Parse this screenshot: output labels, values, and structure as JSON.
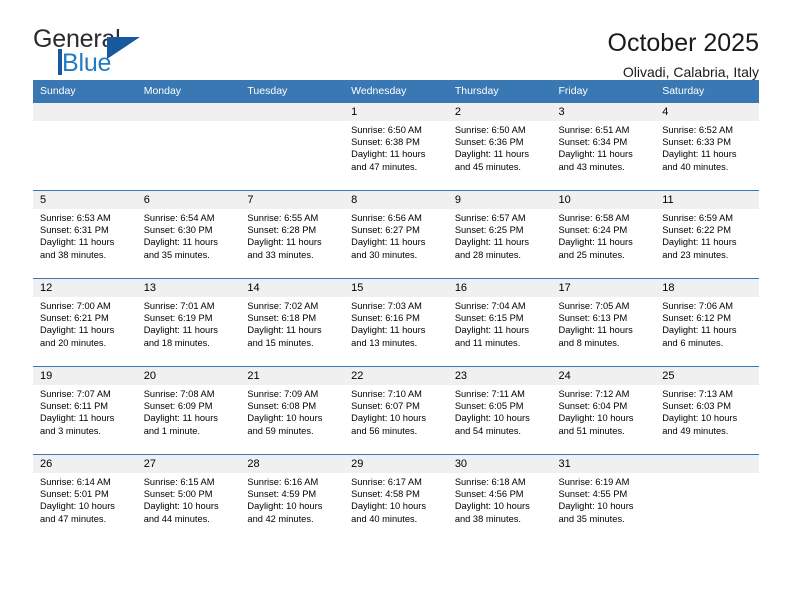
{
  "logo": {
    "word1": "General",
    "word2": "Blue",
    "triangle_color": "#18589f",
    "blue_text_color": "#1f7cc4"
  },
  "header": {
    "title": "October 2025",
    "location": "Olivadi, Calabria, Italy"
  },
  "theme": {
    "header_blue": "#3a78b4",
    "daynum_band": "#f0f0f0",
    "text": "#000000"
  },
  "weekday_headers": [
    "Sunday",
    "Monday",
    "Tuesday",
    "Wednesday",
    "Thursday",
    "Friday",
    "Saturday"
  ],
  "weeks": [
    [
      {
        "day": "",
        "sunrise": "",
        "sunset": "",
        "daylight1": "",
        "daylight2": ""
      },
      {
        "day": "",
        "sunrise": "",
        "sunset": "",
        "daylight1": "",
        "daylight2": ""
      },
      {
        "day": "",
        "sunrise": "",
        "sunset": "",
        "daylight1": "",
        "daylight2": ""
      },
      {
        "day": "1",
        "sunrise": "Sunrise: 6:50 AM",
        "sunset": "Sunset: 6:38 PM",
        "daylight1": "Daylight: 11 hours",
        "daylight2": "and 47 minutes."
      },
      {
        "day": "2",
        "sunrise": "Sunrise: 6:50 AM",
        "sunset": "Sunset: 6:36 PM",
        "daylight1": "Daylight: 11 hours",
        "daylight2": "and 45 minutes."
      },
      {
        "day": "3",
        "sunrise": "Sunrise: 6:51 AM",
        "sunset": "Sunset: 6:34 PM",
        "daylight1": "Daylight: 11 hours",
        "daylight2": "and 43 minutes."
      },
      {
        "day": "4",
        "sunrise": "Sunrise: 6:52 AM",
        "sunset": "Sunset: 6:33 PM",
        "daylight1": "Daylight: 11 hours",
        "daylight2": "and 40 minutes."
      }
    ],
    [
      {
        "day": "5",
        "sunrise": "Sunrise: 6:53 AM",
        "sunset": "Sunset: 6:31 PM",
        "daylight1": "Daylight: 11 hours",
        "daylight2": "and 38 minutes."
      },
      {
        "day": "6",
        "sunrise": "Sunrise: 6:54 AM",
        "sunset": "Sunset: 6:30 PM",
        "daylight1": "Daylight: 11 hours",
        "daylight2": "and 35 minutes."
      },
      {
        "day": "7",
        "sunrise": "Sunrise: 6:55 AM",
        "sunset": "Sunset: 6:28 PM",
        "daylight1": "Daylight: 11 hours",
        "daylight2": "and 33 minutes."
      },
      {
        "day": "8",
        "sunrise": "Sunrise: 6:56 AM",
        "sunset": "Sunset: 6:27 PM",
        "daylight1": "Daylight: 11 hours",
        "daylight2": "and 30 minutes."
      },
      {
        "day": "9",
        "sunrise": "Sunrise: 6:57 AM",
        "sunset": "Sunset: 6:25 PM",
        "daylight1": "Daylight: 11 hours",
        "daylight2": "and 28 minutes."
      },
      {
        "day": "10",
        "sunrise": "Sunrise: 6:58 AM",
        "sunset": "Sunset: 6:24 PM",
        "daylight1": "Daylight: 11 hours",
        "daylight2": "and 25 minutes."
      },
      {
        "day": "11",
        "sunrise": "Sunrise: 6:59 AM",
        "sunset": "Sunset: 6:22 PM",
        "daylight1": "Daylight: 11 hours",
        "daylight2": "and 23 minutes."
      }
    ],
    [
      {
        "day": "12",
        "sunrise": "Sunrise: 7:00 AM",
        "sunset": "Sunset: 6:21 PM",
        "daylight1": "Daylight: 11 hours",
        "daylight2": "and 20 minutes."
      },
      {
        "day": "13",
        "sunrise": "Sunrise: 7:01 AM",
        "sunset": "Sunset: 6:19 PM",
        "daylight1": "Daylight: 11 hours",
        "daylight2": "and 18 minutes."
      },
      {
        "day": "14",
        "sunrise": "Sunrise: 7:02 AM",
        "sunset": "Sunset: 6:18 PM",
        "daylight1": "Daylight: 11 hours",
        "daylight2": "and 15 minutes."
      },
      {
        "day": "15",
        "sunrise": "Sunrise: 7:03 AM",
        "sunset": "Sunset: 6:16 PM",
        "daylight1": "Daylight: 11 hours",
        "daylight2": "and 13 minutes."
      },
      {
        "day": "16",
        "sunrise": "Sunrise: 7:04 AM",
        "sunset": "Sunset: 6:15 PM",
        "daylight1": "Daylight: 11 hours",
        "daylight2": "and 11 minutes."
      },
      {
        "day": "17",
        "sunrise": "Sunrise: 7:05 AM",
        "sunset": "Sunset: 6:13 PM",
        "daylight1": "Daylight: 11 hours",
        "daylight2": "and 8 minutes."
      },
      {
        "day": "18",
        "sunrise": "Sunrise: 7:06 AM",
        "sunset": "Sunset: 6:12 PM",
        "daylight1": "Daylight: 11 hours",
        "daylight2": "and 6 minutes."
      }
    ],
    [
      {
        "day": "19",
        "sunrise": "Sunrise: 7:07 AM",
        "sunset": "Sunset: 6:11 PM",
        "daylight1": "Daylight: 11 hours",
        "daylight2": "and 3 minutes."
      },
      {
        "day": "20",
        "sunrise": "Sunrise: 7:08 AM",
        "sunset": "Sunset: 6:09 PM",
        "daylight1": "Daylight: 11 hours",
        "daylight2": "and 1 minute."
      },
      {
        "day": "21",
        "sunrise": "Sunrise: 7:09 AM",
        "sunset": "Sunset: 6:08 PM",
        "daylight1": "Daylight: 10 hours",
        "daylight2": "and 59 minutes."
      },
      {
        "day": "22",
        "sunrise": "Sunrise: 7:10 AM",
        "sunset": "Sunset: 6:07 PM",
        "daylight1": "Daylight: 10 hours",
        "daylight2": "and 56 minutes."
      },
      {
        "day": "23",
        "sunrise": "Sunrise: 7:11 AM",
        "sunset": "Sunset: 6:05 PM",
        "daylight1": "Daylight: 10 hours",
        "daylight2": "and 54 minutes."
      },
      {
        "day": "24",
        "sunrise": "Sunrise: 7:12 AM",
        "sunset": "Sunset: 6:04 PM",
        "daylight1": "Daylight: 10 hours",
        "daylight2": "and 51 minutes."
      },
      {
        "day": "25",
        "sunrise": "Sunrise: 7:13 AM",
        "sunset": "Sunset: 6:03 PM",
        "daylight1": "Daylight: 10 hours",
        "daylight2": "and 49 minutes."
      }
    ],
    [
      {
        "day": "26",
        "sunrise": "Sunrise: 6:14 AM",
        "sunset": "Sunset: 5:01 PM",
        "daylight1": "Daylight: 10 hours",
        "daylight2": "and 47 minutes."
      },
      {
        "day": "27",
        "sunrise": "Sunrise: 6:15 AM",
        "sunset": "Sunset: 5:00 PM",
        "daylight1": "Daylight: 10 hours",
        "daylight2": "and 44 minutes."
      },
      {
        "day": "28",
        "sunrise": "Sunrise: 6:16 AM",
        "sunset": "Sunset: 4:59 PM",
        "daylight1": "Daylight: 10 hours",
        "daylight2": "and 42 minutes."
      },
      {
        "day": "29",
        "sunrise": "Sunrise: 6:17 AM",
        "sunset": "Sunset: 4:58 PM",
        "daylight1": "Daylight: 10 hours",
        "daylight2": "and 40 minutes."
      },
      {
        "day": "30",
        "sunrise": "Sunrise: 6:18 AM",
        "sunset": "Sunset: 4:56 PM",
        "daylight1": "Daylight: 10 hours",
        "daylight2": "and 38 minutes."
      },
      {
        "day": "31",
        "sunrise": "Sunrise: 6:19 AM",
        "sunset": "Sunset: 4:55 PM",
        "daylight1": "Daylight: 10 hours",
        "daylight2": "and 35 minutes."
      },
      {
        "day": "",
        "sunrise": "",
        "sunset": "",
        "daylight1": "",
        "daylight2": ""
      }
    ]
  ]
}
